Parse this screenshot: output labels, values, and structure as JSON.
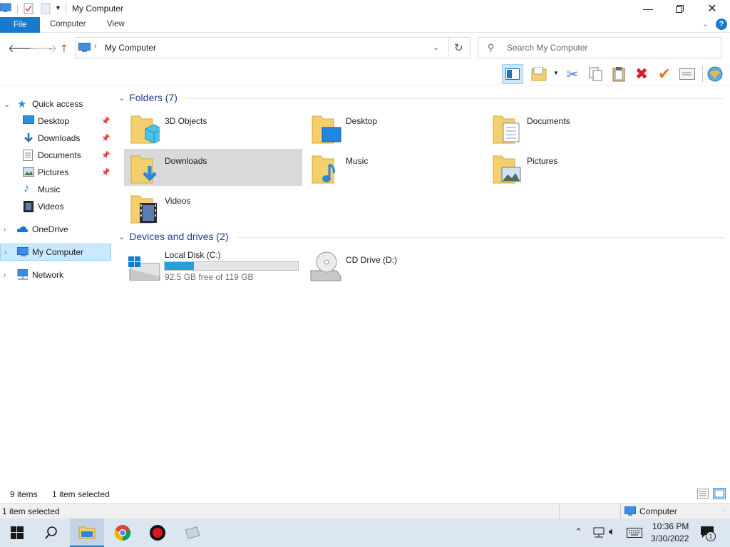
{
  "window": {
    "title": "My Computer"
  },
  "ribbon": {
    "tabs": [
      "File",
      "Computer",
      "View"
    ]
  },
  "address": {
    "path": "My Computer",
    "search_placeholder": "Search My Computer"
  },
  "nav": {
    "quick_access": "Quick access",
    "quick_items": [
      {
        "label": "Desktop",
        "icon": "desktop-icon",
        "pinned": true
      },
      {
        "label": "Downloads",
        "icon": "downloads-icon",
        "pinned": true
      },
      {
        "label": "Documents",
        "icon": "documents-icon",
        "pinned": true
      },
      {
        "label": "Pictures",
        "icon": "pictures-icon",
        "pinned": true
      },
      {
        "label": "Music",
        "icon": "music-icon",
        "pinned": false
      },
      {
        "label": "Videos",
        "icon": "videos-icon",
        "pinned": false
      }
    ],
    "onedrive": "OneDrive",
    "my_computer": "My Computer",
    "network": "Network"
  },
  "content": {
    "folders_header": "Folders (7)",
    "folders": [
      {
        "label": "3D Objects",
        "icon": "3d-objects-icon"
      },
      {
        "label": "Desktop",
        "icon": "desktop-folder-icon"
      },
      {
        "label": "Documents",
        "icon": "documents-folder-icon"
      },
      {
        "label": "Downloads",
        "icon": "downloads-folder-icon",
        "selected": true
      },
      {
        "label": "Music",
        "icon": "music-folder-icon"
      },
      {
        "label": "Pictures",
        "icon": "pictures-folder-icon"
      },
      {
        "label": "Videos",
        "icon": "videos-folder-icon"
      }
    ],
    "drives_header": "Devices and drives (2)",
    "drives": [
      {
        "label": "Local Disk (C:)",
        "free_text": "92.5 GB free of 119 GB",
        "used_fraction": 0.22
      },
      {
        "label": "CD Drive (D:)"
      }
    ]
  },
  "status": {
    "item_count": "9 items",
    "selected": "1 item selected",
    "bottom_left": "1 item selected",
    "bottom_right": "Computer"
  },
  "taskbar": {
    "time": "10:36 PM",
    "date": "3/30/2022",
    "notification_count": "1"
  },
  "colors": {
    "accent": "#1979ca",
    "selected_tile": "#d9d9d9",
    "selected_nav": "#cce8ff",
    "folder": "#f4cf6e",
    "taskbar": "#dbe6f1",
    "delete_red": "#d62020",
    "check_orange": "#e07b1e"
  }
}
